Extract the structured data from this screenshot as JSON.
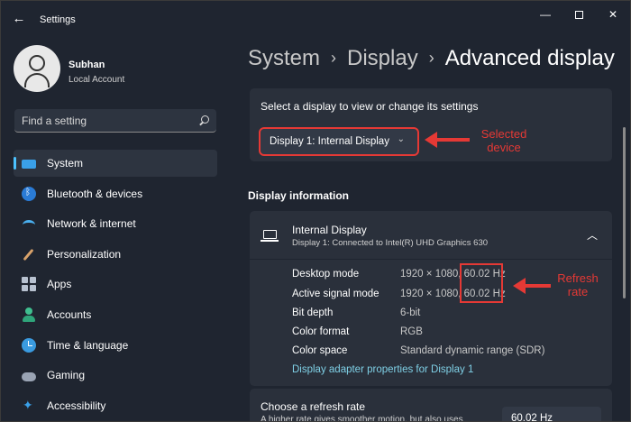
{
  "window": {
    "title": "Settings",
    "back_icon": "arrow-left-icon",
    "controls": {
      "minimize": "—",
      "maximize": "",
      "close": "✕"
    }
  },
  "profile": {
    "name": "Subhan",
    "account_type": "Local Account"
  },
  "search": {
    "placeholder": "Find a setting"
  },
  "nav": {
    "items": [
      {
        "label": "System",
        "icon": "system-icon",
        "active": true
      },
      {
        "label": "Bluetooth & devices",
        "icon": "bluetooth-icon"
      },
      {
        "label": "Network & internet",
        "icon": "network-icon"
      },
      {
        "label": "Personalization",
        "icon": "personalization-icon"
      },
      {
        "label": "Apps",
        "icon": "apps-icon"
      },
      {
        "label": "Accounts",
        "icon": "accounts-icon"
      },
      {
        "label": "Time & language",
        "icon": "time-language-icon"
      },
      {
        "label": "Gaming",
        "icon": "gaming-icon"
      },
      {
        "label": "Accessibility",
        "icon": "accessibility-icon"
      }
    ]
  },
  "breadcrumb": {
    "items": [
      "System",
      "Display"
    ],
    "separator": "›",
    "current": "Advanced display"
  },
  "select_display": {
    "label": "Select a display to view or change its settings",
    "selected": "Display 1: Internal Display"
  },
  "annotations": {
    "selected_device": "Selected device",
    "refresh_rate": "Refresh rate",
    "color": "#e53935"
  },
  "display_info": {
    "section_title": "Display information",
    "title": "Internal Display",
    "subtitle": "Display 1: Connected to Intel(R) UHD Graphics 630",
    "rows": [
      {
        "label": "Desktop mode",
        "value": "1920 × 1080, 60.02 Hz"
      },
      {
        "label": "Active signal mode",
        "value": "1920 × 1080, 60.02 Hz"
      },
      {
        "label": "Bit depth",
        "value": "6-bit"
      },
      {
        "label": "Color format",
        "value": "RGB"
      },
      {
        "label": "Color space",
        "value": "Standard dynamic range (SDR)"
      }
    ],
    "link": "Display adapter properties for Display 1"
  },
  "refresh": {
    "title": "Choose a refresh rate",
    "subtitle": "A higher rate gives smoother motion, but also uses",
    "value": "60.02 Hz"
  }
}
